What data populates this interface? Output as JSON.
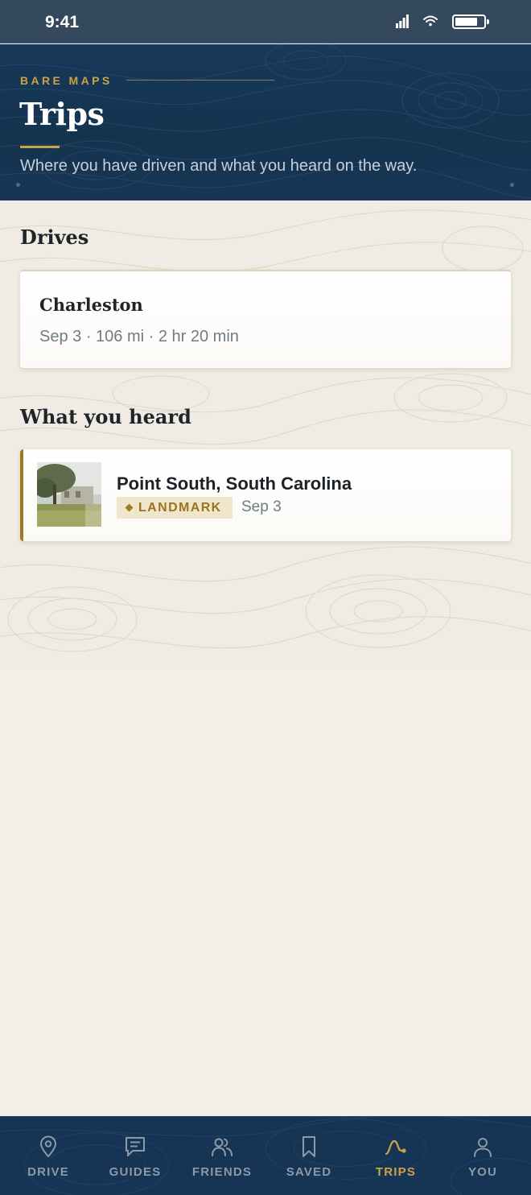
{
  "status_bar": {
    "time": "9:41"
  },
  "header": {
    "brand": "BARE MAPS",
    "title": "Trips",
    "subtitle": "Where you have driven and what you heard on the way."
  },
  "drives": {
    "section_title": "Drives",
    "items": [
      {
        "name": "Charleston",
        "meta": "Sep 3 · 106 mi · 2 hr 20 min"
      }
    ]
  },
  "heard": {
    "section_title": "What you heard",
    "items": [
      {
        "title": "Point South, South Carolina",
        "badge": "LANDMARK",
        "date": "Sep 3"
      }
    ]
  },
  "bottom_nav": {
    "items": [
      {
        "label": "DRIVE",
        "icon": "map-pin-icon",
        "active": false
      },
      {
        "label": "GUIDES",
        "icon": "guide-icon",
        "active": false
      },
      {
        "label": "FRIENDS",
        "icon": "friends-icon",
        "active": false
      },
      {
        "label": "SAVED",
        "icon": "bookmark-icon",
        "active": false
      },
      {
        "label": "TRIPS",
        "icon": "route-icon",
        "active": true
      },
      {
        "label": "YOU",
        "icon": "person-icon",
        "active": false
      }
    ]
  },
  "colors": {
    "accent_gold": "#c9a24a",
    "header_navy": "#17385a",
    "background_cream": "#f3f0e9",
    "inactive_nav": "#8c99a6"
  }
}
